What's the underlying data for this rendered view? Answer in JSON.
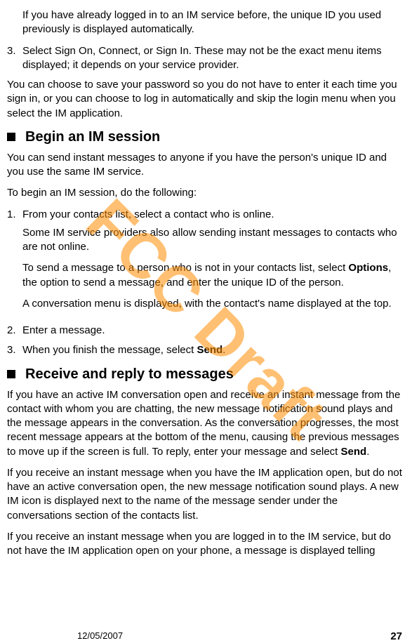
{
  "watermark": "FCC Draft",
  "top_paras": [
    "If you have already logged in to an IM service before, the unique ID you used previously is displayed automatically."
  ],
  "top_list_item": {
    "num": "3.",
    "text": "Select Sign On, Connect, or Sign In. These may not be the exact menu items displayed; it depends on your service provider."
  },
  "save_password_para": "You can choose to save your password so you do not have to enter it each time you sign in, or you can choose to log in automatically and skip the login menu when you select the IM application.",
  "section1": {
    "heading": "Begin an IM session",
    "intro": "You can send instant messages to anyone if you have the person's unique ID and you use the same IM service.",
    "lead": "To begin an IM session, do the following:",
    "items": [
      {
        "num": "1.",
        "paras": [
          "From your contacts list, select a contact who is online.",
          "Some IM service providers also allow sending instant messages to contacts who are not online."
        ],
        "options_pre": "To send a message to a person who is not in your contacts list, select ",
        "options_bold": "Options",
        "options_post": ", the option to send a message, and enter the unique ID of the person.",
        "tail": "A conversation menu is displayed, with the contact's name displayed at the top."
      },
      {
        "num": "2.",
        "text": "Enter a message."
      },
      {
        "num": "3.",
        "pre": "When you finish the message, select ",
        "bold": "Send",
        "post": "."
      }
    ]
  },
  "section2": {
    "heading": "Receive and reply to messages",
    "p1_pre": "If you have an active IM conversation open and receive an instant message from the contact with whom you are chatting, the new message notification sound plays and the message appears in the conversation. As the conversation progresses, the most recent message appears at the bottom of the menu, causing the previous messages to move up if the screen is full. To reply, enter your message and select ",
    "p1_bold": "Send",
    "p1_post": ".",
    "p2": "If you receive an instant message when you have the IM application open, but do not have an active conversation open, the new message notification sound plays. A new IM icon is displayed next to the name of the message sender under the conversations section of the contacts list.",
    "p3": "If you receive an instant message when you are logged in to the IM service, but do not have the IM application open on your phone, a message is displayed telling"
  },
  "footer": {
    "date": "12/05/2007",
    "page": "27"
  }
}
